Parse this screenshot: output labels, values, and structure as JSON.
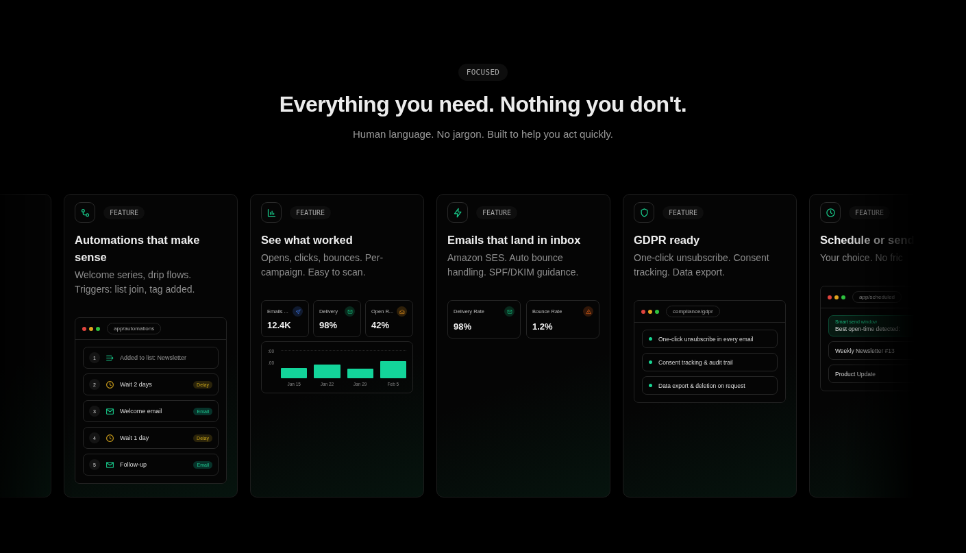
{
  "header": {
    "eyebrow": "FOCUSED",
    "title": "Everything you need. Nothing you don't.",
    "subtitle": "Human language. No jargon. Built to help you act quickly."
  },
  "cards": [
    {
      "kind": "steps",
      "tag": "FEATURE",
      "title": "Automations that make sense",
      "description": "Welcome series, drip flows. Triggers: list join, tag added.",
      "window_path": "app/automations",
      "steps": [
        {
          "kind": "trigger",
          "number": "1",
          "label": "Added to list: Newsletter",
          "muted": true
        },
        {
          "kind": "delay",
          "number": "2",
          "label": "Wait 2 days",
          "badge": "Delay",
          "muted": false
        },
        {
          "kind": "email",
          "number": "3",
          "label": "Welcome email",
          "badge": "Email",
          "muted": false
        },
        {
          "kind": "delay",
          "number": "4",
          "label": "Wait 1 day",
          "badge": "Delay",
          "muted": false
        },
        {
          "kind": "email",
          "number": "5",
          "label": "Follow-up",
          "badge": "Email",
          "muted": false
        }
      ]
    },
    {
      "kind": "stats_chart",
      "tag": "FEATURE",
      "title": "See what worked",
      "description": "Opens, clicks, bounces. Per-campaign. Easy to scan.",
      "stats": [
        {
          "kind": "sent",
          "label": "Emails ...",
          "value": "12.4K"
        },
        {
          "kind": "delivery",
          "label": "Delivery",
          "value": "98%"
        },
        {
          "kind": "opens",
          "label": "Open R...",
          "value": "42%"
        }
      ],
      "chart": {
        "tick_labels": [
          ":00",
          ".00"
        ],
        "x_labels": [
          "Jan 15",
          "Jan 22",
          "Jan 29",
          "Feb 5"
        ]
      }
    },
    {
      "kind": "stats",
      "tag": "FEATURE",
      "title": "Emails that land in inbox",
      "description": "Amazon SES. Auto bounce handling. SPF/DKIM guidance.",
      "stats": [
        {
          "kind": "delivery",
          "label": "Delivery Rate",
          "value": "98%"
        },
        {
          "kind": "bounce",
          "label": "Bounce Rate",
          "value": "1.2%"
        }
      ]
    },
    {
      "kind": "checklist",
      "tag": "FEATURE",
      "title": "GDPR ready",
      "description": "One-click unsubscribe. Consent tracking. Data export.",
      "window_path": "compliance/gdpr",
      "items": [
        {
          "label": "One-click unsubscribe in every email"
        },
        {
          "label": "Consent tracking & audit trail"
        },
        {
          "label": "Data export & deletion on request"
        }
      ]
    },
    {
      "kind": "schedule",
      "tag": "FEATURE",
      "title": "Schedule or send",
      "description": "Your choice. No fric",
      "window_path": "app/scheduled",
      "highlight": {
        "label": "Smart send window",
        "text": "Best open-time detected:"
      },
      "rows": [
        "Weekly Newsletter #13",
        "Product Update"
      ]
    }
  ]
}
